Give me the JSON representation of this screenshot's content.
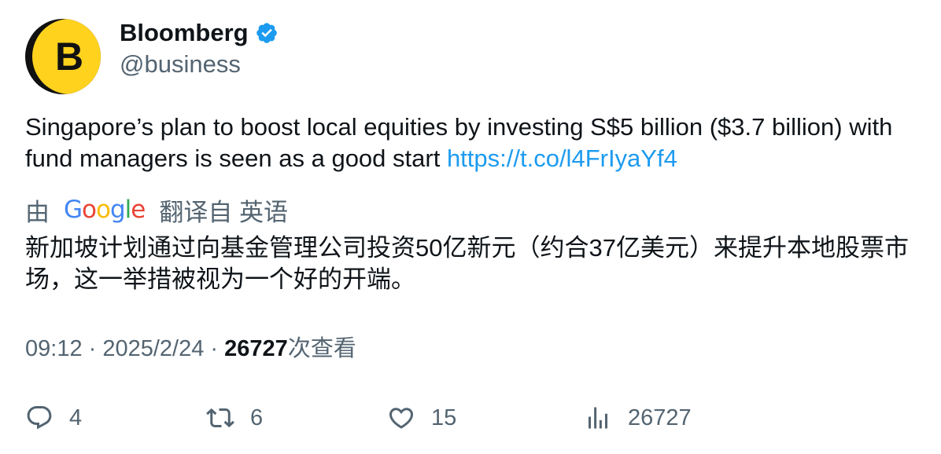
{
  "author": {
    "avatar_letter": "B",
    "name": "Bloomberg",
    "handle": "@business",
    "verified": true
  },
  "tweet": {
    "text": "Singapore’s plan to boost local equities by investing S$5 billion ($3.7 billion) with fund managers is seen as a good start ",
    "link": "https://t.co/l4FrIyaYf4"
  },
  "translation": {
    "by_label": "由",
    "provider": "Google",
    "from_label": "翻译自 英语",
    "text": "新加坡计划通过向基金管理公司投资50亿新元（约合37亿美元）来提升本地股票市场，这一举措被视为一个好的开端。"
  },
  "meta": {
    "time": "09:12",
    "separator": " · ",
    "date": "2025/2/24",
    "views_count": "26727",
    "views_label": "次查看"
  },
  "actions": {
    "replies": "4",
    "retweets": "6",
    "likes": "15",
    "views": "26727"
  },
  "colors": {
    "link": "#1d9bf0",
    "secondary_text": "#536471",
    "verified": "#1d9bf0",
    "avatar_yellow": "#ffd21e"
  },
  "icons": [
    "verified-badge-icon",
    "reply-icon",
    "retweet-icon",
    "like-icon",
    "views-icon"
  ]
}
